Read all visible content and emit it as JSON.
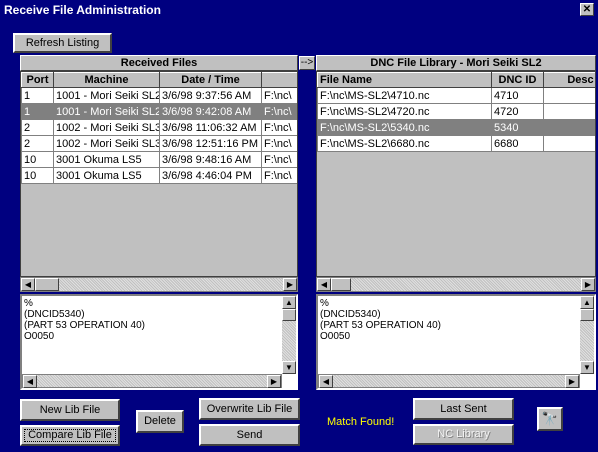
{
  "window": {
    "title": "Receive File Administration",
    "close_glyph": "✕"
  },
  "toolbar": {
    "refresh_label": "Refresh Listing"
  },
  "received": {
    "header": "Received Files",
    "columns": [
      "Port",
      "Machine",
      "Date / Time",
      ""
    ],
    "rows": [
      [
        "1",
        "1001 - Mori Seiki SL2",
        "3/6/98 9:37:56 AM",
        "F:\\nc\\"
      ],
      [
        "1",
        "1001 - Mori Seiki SL2",
        "3/6/98 9:42:08 AM",
        "F:\\nc\\"
      ],
      [
        "2",
        "1002 - Mori Seiki SL3",
        "3/6/98 11:06:32 AM",
        "F:\\nc\\"
      ],
      [
        "2",
        "1002 - Mori Seiki SL3",
        "3/6/98 12:51:16 PM",
        "F:\\nc\\"
      ],
      [
        "10",
        "3001 Okuma LS5",
        "3/6/98 9:48:16 AM",
        "F:\\nc\\"
      ],
      [
        "10",
        "3001 Okuma LS5",
        "3/6/98 4:46:04 PM",
        "F:\\nc\\"
      ]
    ],
    "selected_row": 1,
    "preview": "%\n(DNCID5340)\n(PART 53 OPERATION 40)\nO0050"
  },
  "arrow_label": "-->",
  "library": {
    "header": "DNC File Library - Mori Seiki SL2",
    "columns": [
      "File Name",
      "DNC ID",
      "Desc"
    ],
    "rows": [
      [
        "F:\\nc\\MS-SL2\\4710.nc",
        "4710",
        ""
      ],
      [
        "F:\\nc\\MS-SL2\\4720.nc",
        "4720",
        ""
      ],
      [
        "F:\\nc\\MS-SL2\\5340.nc",
        "5340",
        ""
      ],
      [
        "F:\\nc\\MS-SL2\\6680.nc",
        "6680",
        ""
      ]
    ],
    "selected_row": 2,
    "preview": "%\n(DNCID5340)\n(PART 53 OPERATION 40)\nO0050"
  },
  "buttons": {
    "new_lib": "New Lib File",
    "compare_lib": "Compare Lib File",
    "delete": "Delete",
    "overwrite_lib": "Overwrite Lib File",
    "send": "Send",
    "last_sent": "Last Sent",
    "nc_library": "NC Library",
    "find_glyph": "🔭"
  },
  "status": {
    "match_text": "Match Found!"
  },
  "colors": {
    "window_bg": "#000080",
    "control_bg": "#c0c0c0",
    "selection": "#808080",
    "match_text": "#ffff00"
  }
}
